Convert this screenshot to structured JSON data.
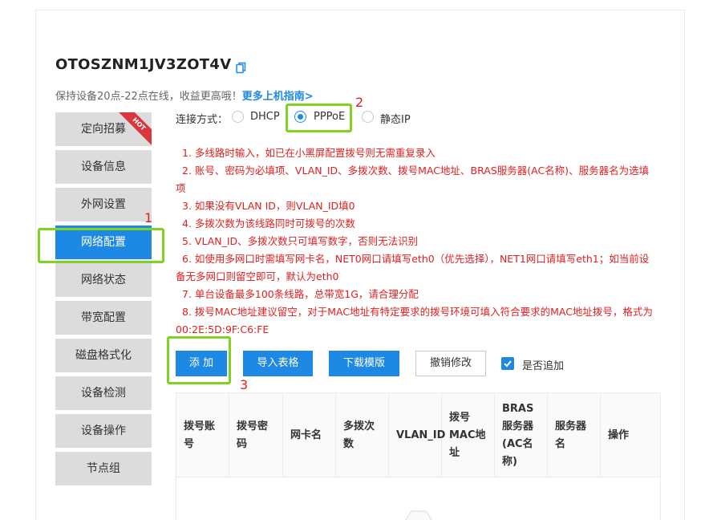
{
  "device": {
    "id": "OTOSZNM1JV3ZOT4V",
    "notice_prefix": "保持设备20点-22点在线，收益更高哦！",
    "notice_link": "更多上机指南>"
  },
  "sidebar": {
    "items": [
      {
        "label": "定向招募",
        "badge": "HOT"
      },
      {
        "label": "设备信息"
      },
      {
        "label": "外网设置"
      },
      {
        "label": "网络配置"
      },
      {
        "label": "网络状态"
      },
      {
        "label": "带宽配置"
      },
      {
        "label": "磁盘格式化"
      },
      {
        "label": "设备检测"
      },
      {
        "label": "设备操作"
      },
      {
        "label": "节点组"
      }
    ],
    "active_index": 3
  },
  "connection": {
    "label": "连接方式：",
    "options": [
      "DHCP",
      "PPPoE",
      "静态IP"
    ],
    "selected": "PPPoE"
  },
  "notes": [
    "1. 多线路时输入，如已在小黑屏配置拨号则无需重复录入",
    "2. 账号、密码为必填项、VLAN_ID、多拨次数、拨号MAC地址、BRAS服务器(AC名称)、服务器名为选填项",
    "3. 如果没有VLAN ID，则VLAN_ID填0",
    "4. 多拨次数为该线路同时可拨号的次数",
    "5. VLAN_ID、多拨次数只可填写数字，否则无法识别",
    "6. 如使用多网口时需填写网卡名，NET0网口请填写eth0（优先选择），NET1网口请填写eth1；如当前设备无多网口则留空即可，默认为eth0",
    "7. 单台设备最多100条线路，总带宽1G，请合理分配",
    "8. 拨号MAC地址建议留空，对于MAC地址有特定要求的拨号环境可填入符合要求的MAC地址拨号，格式为00:2E:5D:9F:C6:FE"
  ],
  "toolbar": {
    "add": "添 加",
    "import": "导入表格",
    "download": "下载模版",
    "revert": "撤销修改",
    "append_label": "是否追加",
    "append_checked": true
  },
  "table": {
    "headers": [
      "拨号账号",
      "拨号密码",
      "网卡名",
      "多拨次数",
      "VLAN_ID",
      "拨号MAC地址",
      "BRAS服务器(AC名称)",
      "服务器名",
      "操作"
    ]
  },
  "annotations": [
    "1",
    "2",
    "3"
  ],
  "colors": {
    "primary": "#1e88e5",
    "annotation_box": "#7ed321",
    "annotation_text": "#e02020",
    "hot_badge": "#d9363e"
  }
}
